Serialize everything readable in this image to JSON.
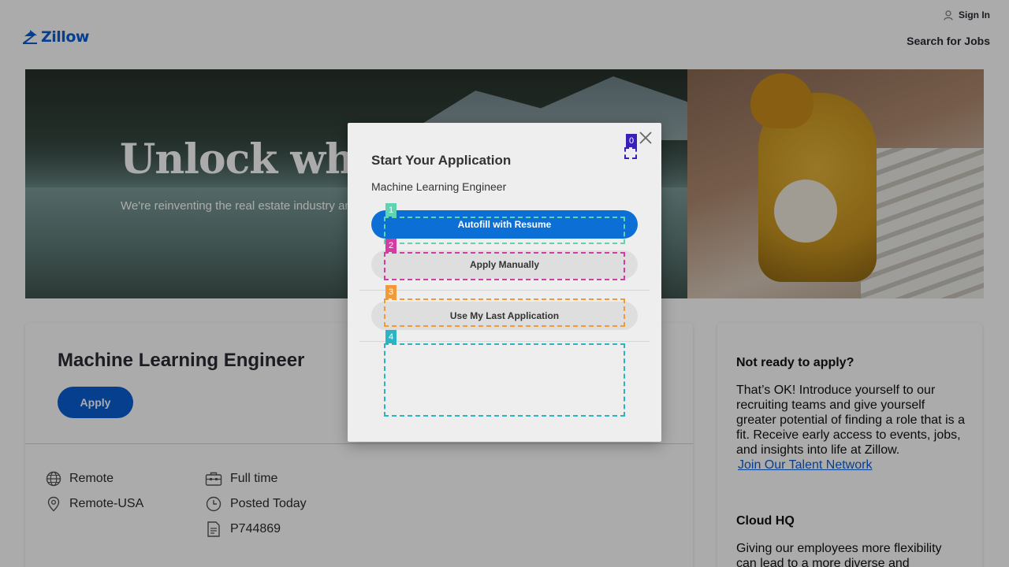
{
  "header": {
    "logo_text": "Zillow",
    "sign_in_label": "Sign In",
    "search_jobs_label": "Search for Jobs",
    "brand_color": "#0b5fd6"
  },
  "hero": {
    "title": "Unlock what’s next",
    "subtitle": "We're reinventing the real estate industry and helping customers get home from our homes"
  },
  "job": {
    "title": "Machine Learning Engineer",
    "apply_label": "Apply",
    "meta": {
      "work_type": "Remote",
      "location": "Remote-USA",
      "schedule": "Full time",
      "posted": "Posted Today",
      "requisition": "P744869"
    }
  },
  "sidebar": {
    "section1_heading": "Not ready to apply?",
    "section1_body": "That’s OK! Introduce yourself to our recruiting teams and give yourself greater potential of finding a role that is a fit. Receive early access to events, jobs, and insights into life at Zillow.",
    "section1_link": "Join Our Talent Network",
    "section2_heading": "Cloud HQ",
    "section2_body": "Giving our employees more flexibility can lead to a more diverse and"
  },
  "modal": {
    "title": "Start Your Application",
    "subtitle": "Machine Learning Engineer",
    "autofill_label": "Autofill with Resume",
    "manual_label": "Apply Manually",
    "last_app_label": "Use My Last Application"
  },
  "markers": [
    "0",
    "1",
    "2",
    "3",
    "4"
  ]
}
